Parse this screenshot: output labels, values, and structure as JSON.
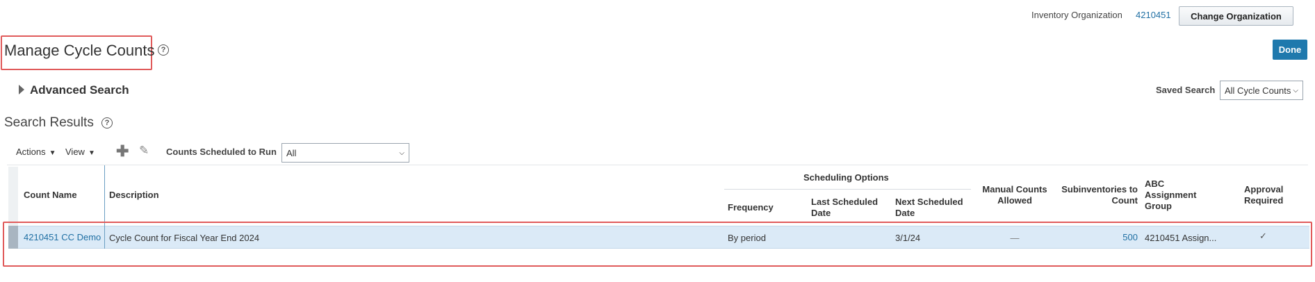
{
  "header": {
    "org_label": "Inventory Organization",
    "org_value": "4210451",
    "change_org_button": "Change Organization",
    "page_title": "Manage Cycle Counts",
    "done_button": "Done",
    "help_glyph": "?"
  },
  "search": {
    "advanced_label": "Advanced Search",
    "saved_label": "Saved Search",
    "saved_value": "All Cycle Counts"
  },
  "results": {
    "title": "Search Results",
    "toolbar": {
      "actions_label": "Actions",
      "view_label": "View",
      "add_icon": "plus-icon",
      "edit_icon": "pencil-icon",
      "counts_label": "Counts Scheduled to Run",
      "counts_value": "All"
    },
    "columns": {
      "count_name": "Count Name",
      "description": "Description",
      "scheduling_options": "Scheduling Options",
      "frequency": "Frequency",
      "last_scheduled": "Last Scheduled Date",
      "next_scheduled": "Next Scheduled Date",
      "manual_counts": "Manual Counts Allowed",
      "subinventories": "Subinventories to Count",
      "abc_group": "ABC Assignment Group",
      "approval": "Approval Required"
    },
    "rows": [
      {
        "count_name": "4210451 CC Demo",
        "description": "Cycle Count for Fiscal Year End 2024",
        "frequency": "By period",
        "last_scheduled": "",
        "next_scheduled": "3/1/24",
        "manual_counts": "—",
        "subinventories": "500",
        "abc_group": "4210451 Assign...",
        "approval": "✓"
      }
    ]
  },
  "colors": {
    "accent": "#1f79ad",
    "link": "#1f6fa3",
    "highlight_box": "#e05a5a",
    "selected_row": "#dbeaf7"
  }
}
